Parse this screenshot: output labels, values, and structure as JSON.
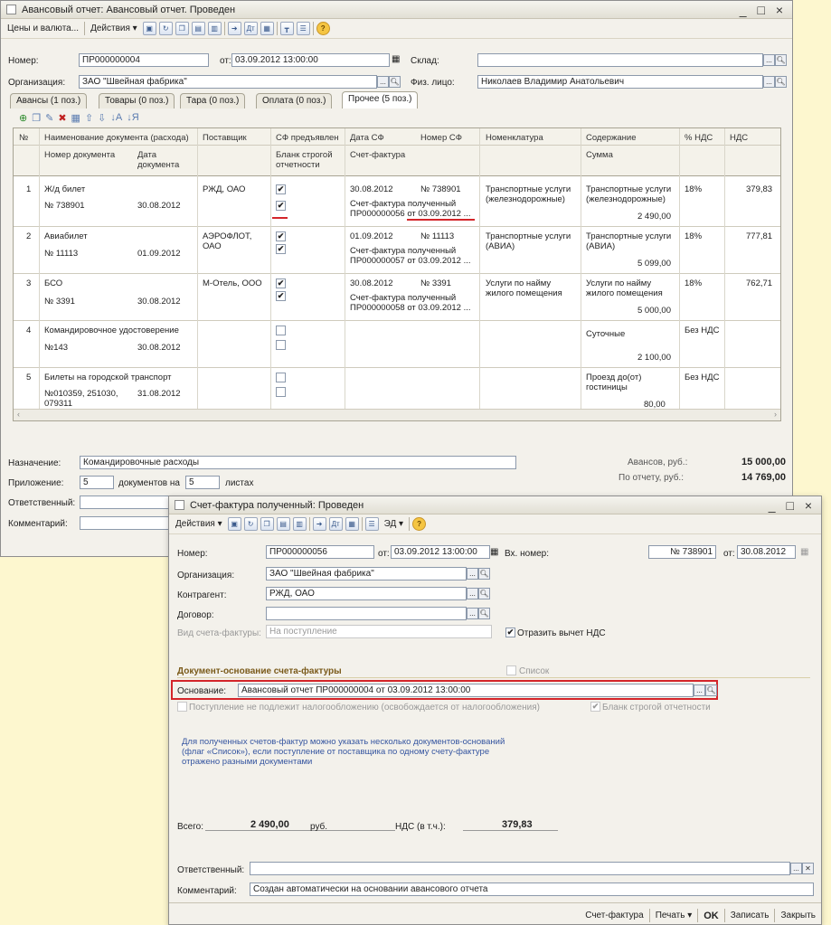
{
  "main": {
    "title": "Авансовый отчет: Авансовый отчет. Проведен",
    "window_controls": "_ □ ×",
    "toolbar": {
      "prices": "Цены и валюта...",
      "actions": "Действия ▾"
    },
    "fields": {
      "number_label": "Номер:",
      "number": "ПР000000004",
      "date_label": "от:",
      "date": "03.09.2012 13:00:00",
      "warehouse_label": "Склад:",
      "warehouse": "",
      "org_label": "Организация:",
      "org": "ЗАО \"Швейная фабрика\"",
      "person_label": "Физ. лицо:",
      "person": "Николаев Владимир Анатольевич"
    },
    "tabs": [
      "Авансы (1 поз.)",
      "Товары (0 поз.)",
      "Тара (0 поз.)",
      "Оплата (0 поз.)",
      "Прочее (5 поз.)"
    ],
    "table": {
      "headers_row1": [
        "№",
        "Наименование документа (расхода)",
        "Поставщик",
        "СФ предъявлен",
        "Дата СФ",
        "Номер СФ",
        "Номенклатура",
        "Содержание",
        "% НДС",
        "НДС"
      ],
      "headers_row2": [
        "Номер документа",
        "Дата документа",
        "Бланк строгой отчетности",
        "Счет-фактура",
        "Сумма"
      ],
      "rows": [
        {
          "n": "1",
          "name": "Ж/д билет",
          "doc_no": "№ 738901",
          "doc_date": "30.08.2012",
          "supplier": "РЖД, ОАО",
          "sf": "✔",
          "bso": "✔",
          "sf_date": "30.08.2012",
          "sf_no": "№ 738901",
          "invoice1": "Счет-фактура полученный",
          "invoice2": "ПР000000056 от 03.09.2012 ...",
          "nom1": "Транспортные услуги",
          "nom2": "(железнодорожные)",
          "cont1": "Транспортные услуги",
          "cont2": "(железнодорожные)",
          "sum": "2 490,00",
          "vat_rate": "18%",
          "vat": "379,83"
        },
        {
          "n": "2",
          "name": "Авиабилет",
          "doc_no": "№ 11113",
          "doc_date": "01.09.2012",
          "supplier": "АЭРОФЛОТ,",
          "supplier2": "ОАО",
          "sf": "✔",
          "bso": "✔",
          "sf_date": "01.09.2012",
          "sf_no": "№ 11113",
          "invoice1": "Счет-фактура полученный",
          "invoice2": "ПР000000057 от 03.09.2012 ...",
          "nom1": "Транспортные услуги",
          "nom2": "(АВИА)",
          "cont1": "Транспортные услуги",
          "cont2": "(АВИА)",
          "sum": "5 099,00",
          "vat_rate": "18%",
          "vat": "777,81"
        },
        {
          "n": "3",
          "name": "БСО",
          "doc_no": "№ 3391",
          "doc_date": "30.08.2012",
          "supplier": "М-Отель, ООО",
          "sf": "✔",
          "bso": "✔",
          "sf_date": "30.08.2012",
          "sf_no": "№ 3391",
          "invoice1": "Счет-фактура полученный",
          "invoice2": "ПР000000058 от 03.09.2012 ...",
          "nom1": "Услуги по найму",
          "nom2": "жилого помещения",
          "cont1": "Услуги по найму",
          "cont2": "жилого помещения",
          "sum": "5 000,00",
          "vat_rate": "18%",
          "vat": "762,71"
        },
        {
          "n": "4",
          "name": "Командировочное удостоверение",
          "doc_no": "№143",
          "doc_date": "30.08.2012",
          "cont1": "Суточные",
          "sum": "2 100,00",
          "vat_rate": "Без НДС"
        },
        {
          "n": "5",
          "name": "Билеты на городской транспорт",
          "doc_no": "№010359, 251030,",
          "doc_no2": "079311",
          "doc_date": "31.08.2012",
          "cont1": "Проезд до(от)",
          "cont2": "гостиницы",
          "sum": "80,00",
          "vat_rate": "Без НДС"
        }
      ]
    },
    "footer": {
      "purpose_label": "Назначение:",
      "purpose": "Командировочные расходы",
      "attach_label": "Приложение:",
      "attach_docs": "5",
      "docs_on": "документов на",
      "attach_sheets": "5",
      "sheets": "листах",
      "resp_label": "Ответственный:",
      "comment_label": "Комментарий:",
      "advances_label": "Авансов, руб.:",
      "advances": "15 000,00",
      "report_label": "По отчету, руб.:",
      "report": "14 769,00"
    }
  },
  "dialog": {
    "title": "Счет-фактура полученный: Проведен",
    "window_controls": "_ □ ×",
    "toolbar": {
      "actions": "Действия ▾",
      "ed": "ЭД ▾"
    },
    "number_label": "Номер:",
    "number": "ПР000000056",
    "date_label": "от:",
    "date": "03.09.2012 13:00:00",
    "in_number_label": "Вх. номер:",
    "in_number": "№ 738901",
    "in_date_label": "от:",
    "in_date": "30.08.2012",
    "org_label": "Организация:",
    "org": "ЗАО \"Швейная фабрика\"",
    "contractor_label": "Контрагент:",
    "contractor": "РЖД, ОАО",
    "contract_label": "Договор:",
    "contract": "",
    "kind_label": "Вид счета-фактуры:",
    "kind": "На поступление",
    "reflect_vat": "Отразить вычет НДС",
    "basis_section": "Документ-основание счета-фактуры",
    "list_label": "Список",
    "basis_label": "Основание:",
    "basis": "Авансовый отчет ПР000000004 от 03.09.2012 13:00:00",
    "not_taxed": "Поступление не подлежит налогообложению (освобождается от налогообложения)",
    "bso_label": "Бланк строгой отчетности",
    "hint1": "Для полученных счетов-фактур можно указать несколько документов-оснований",
    "hint2": "(флаг «Список»), если поступление от поставщика по одному счету-фактуре",
    "hint3": "отражено разными документами",
    "total_label": "Всего:",
    "total": "2 490,00",
    "currency": "руб.",
    "vat_label": "НДС (в т.ч.):",
    "vat": "379,83",
    "resp_label": "Ответственный:",
    "resp": "",
    "comment_label": "Комментарий:",
    "comment": "Создан автоматически на основании авансового отчета",
    "bottom": {
      "invoice": "Счет-фактура",
      "print": "Печать ▾",
      "ok": "OK",
      "save": "Записать",
      "close": "Закрыть"
    }
  }
}
